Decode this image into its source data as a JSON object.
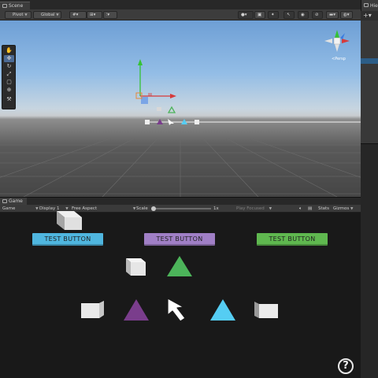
{
  "scene": {
    "tab_label": "Scene",
    "toolbar": {
      "pivot": "Pivot",
      "global": "Global"
    }
  },
  "hierarchy": {
    "tab_label": "Hie"
  },
  "game": {
    "tab_label": "Game",
    "toolbar": {
      "mode": "Game",
      "display": "Display 1",
      "aspect": "Free Aspect",
      "scale_label": "Scale",
      "scale_value": "1x",
      "play_focused": "Play Focused",
      "stats": "Stats",
      "gizmos": "Gizmos"
    },
    "buttons": [
      {
        "label": "TEST BUTTON",
        "color": "#4fb6df"
      },
      {
        "label": "TEST BUTTON",
        "color": "#a07fc6"
      },
      {
        "label": "TEST BUTTON",
        "color": "#5fb84f"
      }
    ]
  },
  "colors": {
    "cyan": "#55cdf3",
    "purple": "#7a3d8c",
    "green": "#4cb45a",
    "white_cube": "#e6e6e6",
    "axis_x": "#d63a3a",
    "axis_y": "#35c235",
    "axis_z": "#3b7de0"
  },
  "icons": [
    "hand-icon",
    "move-icon",
    "rotate-icon",
    "scale-icon",
    "rect-icon",
    "transform-icon",
    "custom-tool-icon",
    "scene-gizmo-icon",
    "cursor-arrow-icon",
    "help-icon"
  ]
}
